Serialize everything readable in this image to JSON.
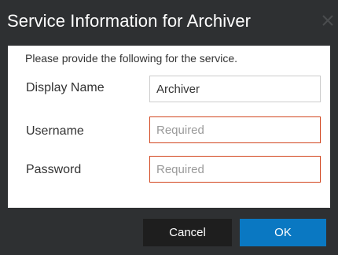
{
  "dialog": {
    "title": "Service Information for Archiver",
    "intro": "Please provide the following for the service."
  },
  "fields": {
    "display_name": {
      "label": "Display Name",
      "value": "Archiver",
      "placeholder": ""
    },
    "username": {
      "label": "Username",
      "value": "",
      "placeholder": "Required"
    },
    "password": {
      "label": "Password",
      "value": "",
      "placeholder": "Required"
    }
  },
  "buttons": {
    "cancel": "Cancel",
    "ok": "OK"
  },
  "icons": {
    "close": "close-icon"
  },
  "colors": {
    "titlebar": "#2e3032",
    "primary": "#0a78c2",
    "required_border": "#d2461f"
  }
}
